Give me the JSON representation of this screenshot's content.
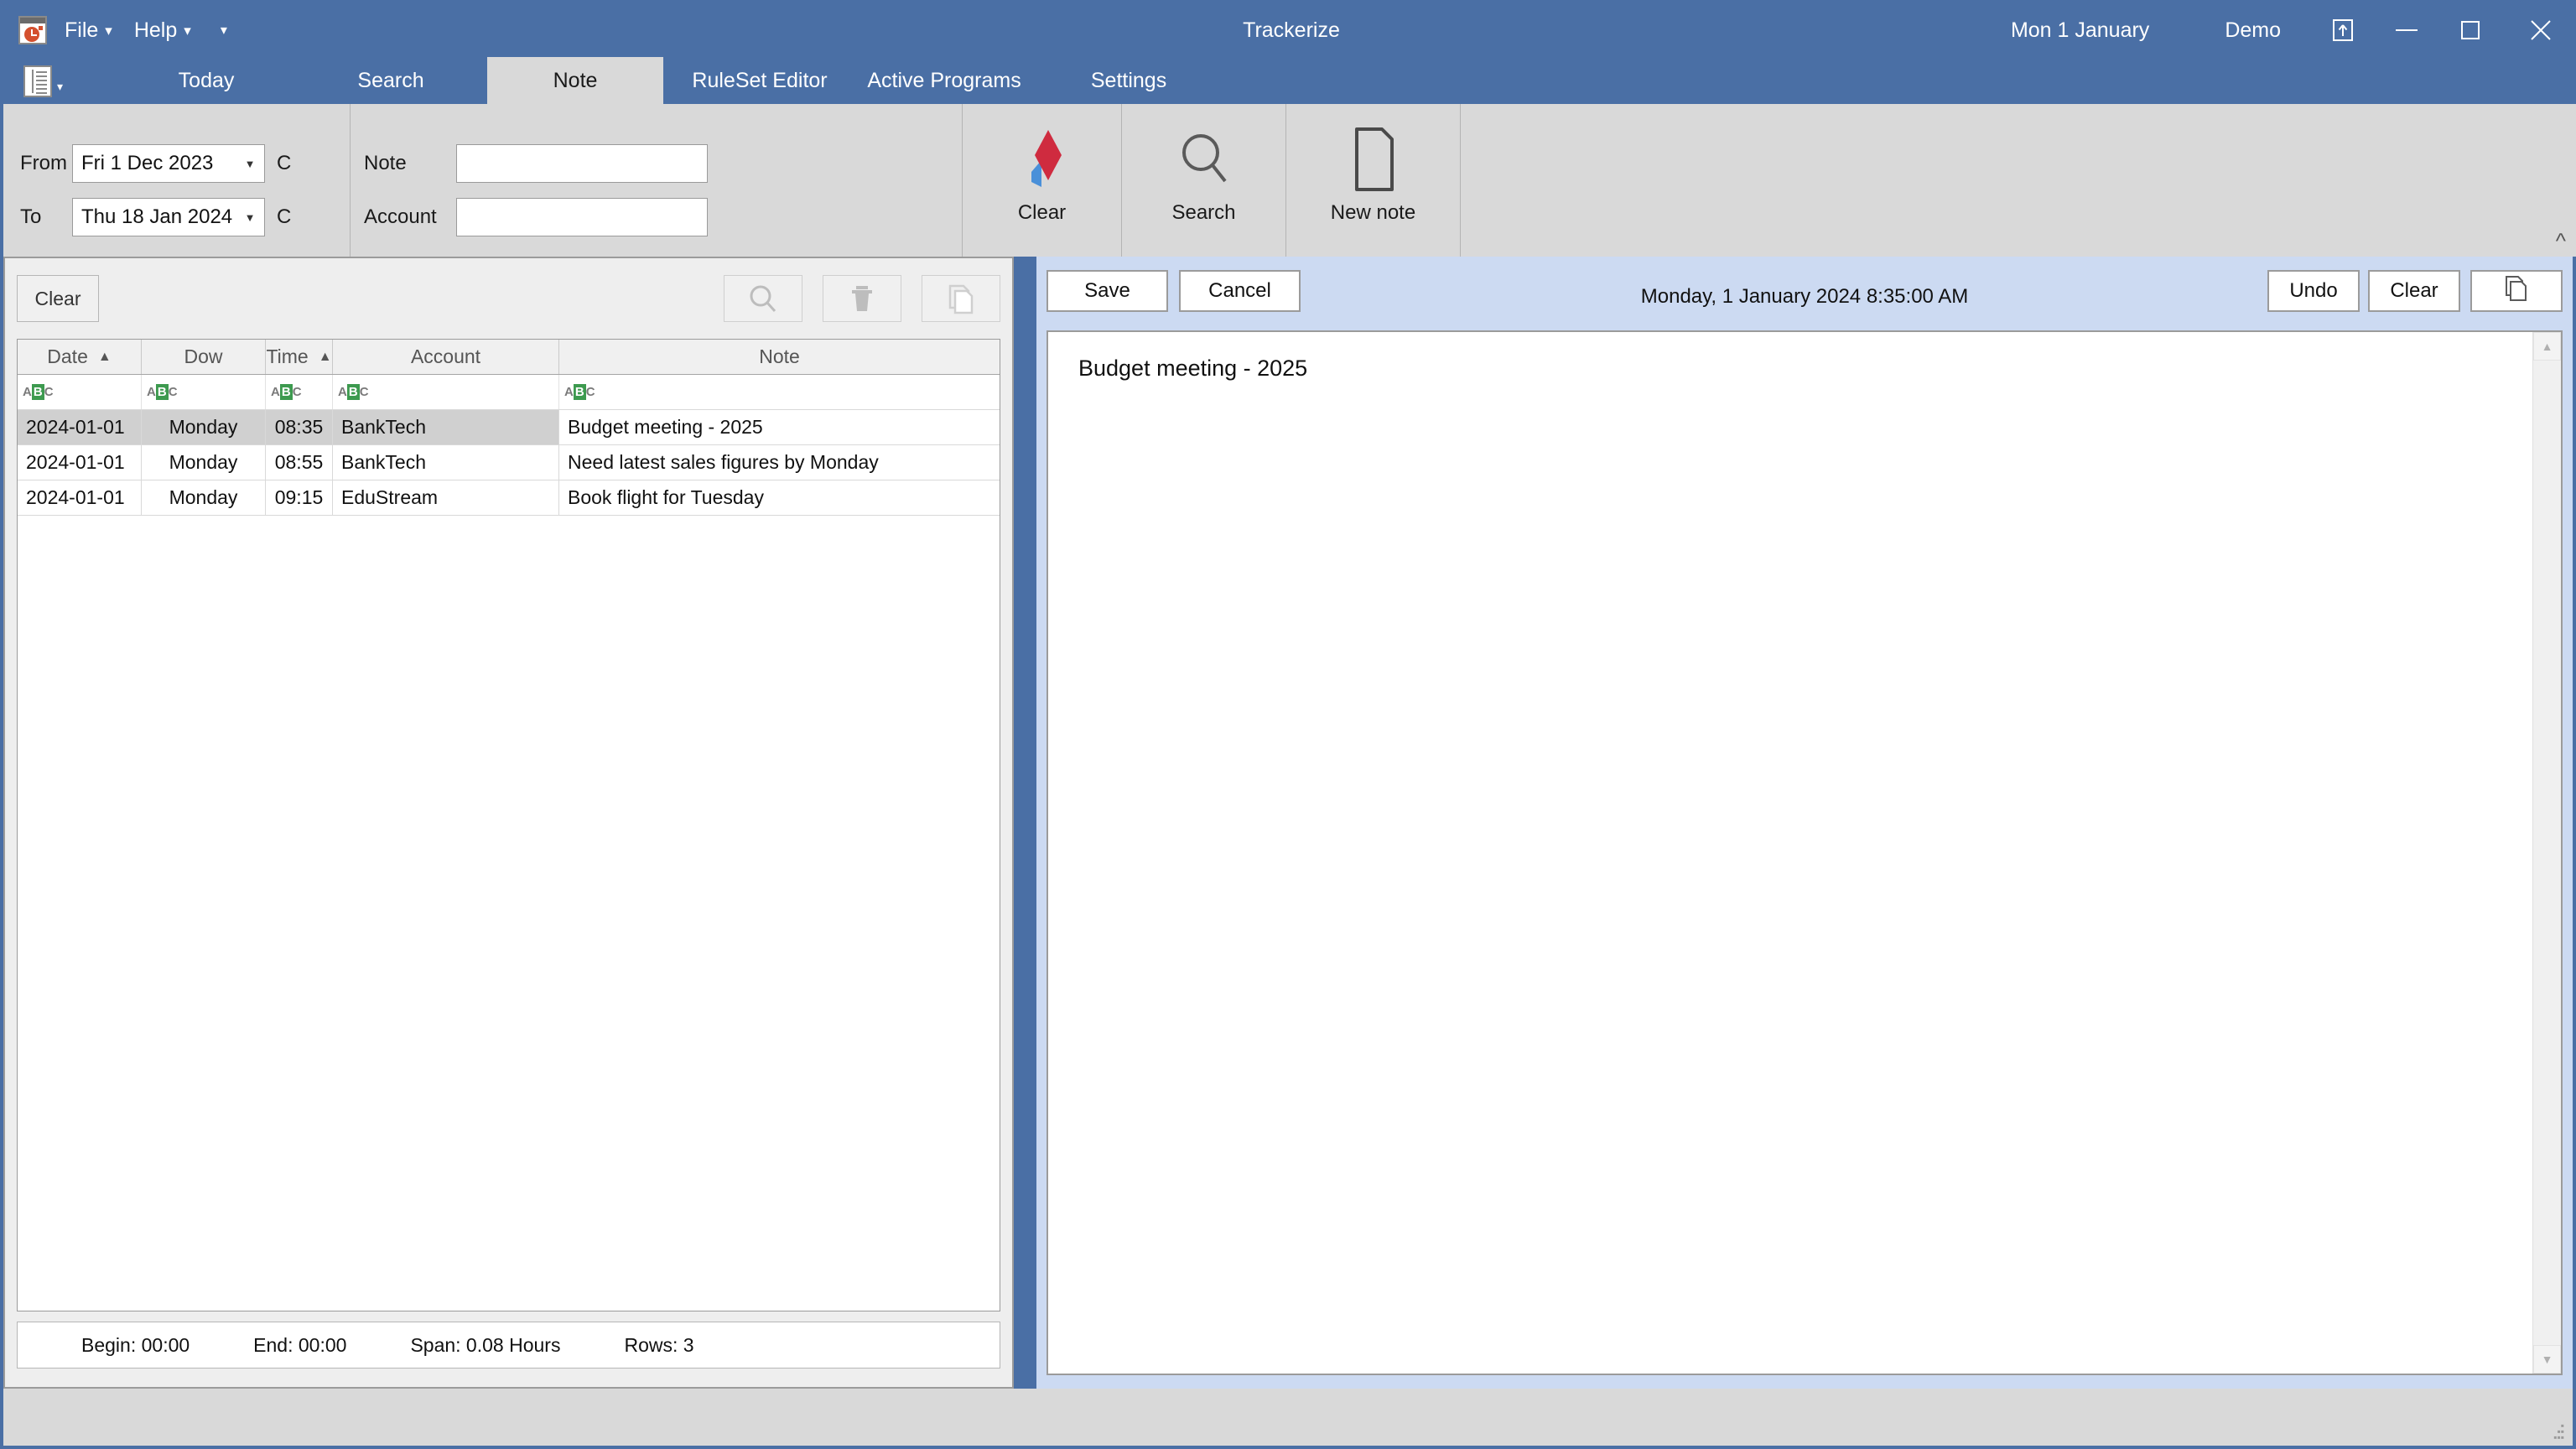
{
  "window": {
    "title": "Trackerize",
    "date_label": "Mon 1 January",
    "mode_label": "Demo",
    "app_icon": "clock-app-icon",
    "pin_icon": "pin-window-icon",
    "minimize_icon": "minimize-icon",
    "maximize_icon": "maximize-icon",
    "close_icon": "close-icon"
  },
  "menu": {
    "file": "File",
    "help": "Help",
    "more_icon": "chevron-down-icon"
  },
  "tabs": {
    "list_icon": "document-list-icon",
    "items": [
      {
        "label": "Today",
        "active": false
      },
      {
        "label": "Search",
        "active": false
      },
      {
        "label": "Note",
        "active": true
      },
      {
        "label": "RuleSet Editor",
        "active": false
      },
      {
        "label": "Active Programs",
        "active": false
      },
      {
        "label": "Settings",
        "active": false
      }
    ]
  },
  "ribbon": {
    "from_label": "From",
    "from_value": "Fri 1 Dec 2023",
    "from_c": "C",
    "to_label": "To",
    "to_value": "Thu 18 Jan 2024",
    "to_c": "C",
    "note_label": "Note",
    "note_value": "",
    "note_placeholder": "",
    "account_label": "Account",
    "account_value": "",
    "account_placeholder": "",
    "buttons": [
      {
        "label": "Clear",
        "icon": "diamond-clear-icon"
      },
      {
        "label": "Search",
        "icon": "magnifier-icon"
      },
      {
        "label": "New note",
        "icon": "new-document-icon"
      }
    ],
    "collapse_icon": "chevron-up-icon"
  },
  "left_panel": {
    "clear_button": "Clear",
    "icon_buttons": [
      {
        "name": "search-icon",
        "enabled": false
      },
      {
        "name": "delete-icon",
        "enabled": false
      },
      {
        "name": "copy-icon",
        "enabled": false
      }
    ],
    "grid": {
      "columns": [
        {
          "label": "Date",
          "sort": "asc"
        },
        {
          "label": "Dow",
          "sort": ""
        },
        {
          "label": "Time",
          "sort": "asc"
        },
        {
          "label": "Account",
          "sort": ""
        },
        {
          "label": "Note",
          "sort": ""
        }
      ],
      "filter_glyph": {
        "a": "A",
        "b": "B",
        "c": "C",
        "highlight_color": "#3d9a4f"
      },
      "rows": [
        {
          "date": "2024-01-01",
          "dow": "Monday",
          "time": "08:35",
          "account": "BankTech",
          "note": "Budget meeting - 2025",
          "selected": true
        },
        {
          "date": "2024-01-01",
          "dow": "Monday",
          "time": "08:55",
          "account": "BankTech",
          "note": "Need latest sales figures by Monday",
          "selected": false
        },
        {
          "date": "2024-01-01",
          "dow": "Monday",
          "time": "09:15",
          "account": "EduStream",
          "note": "Book flight for Tuesday",
          "selected": false
        }
      ]
    },
    "status": {
      "begin": "Begin: 00:00",
      "end": "End: 00:00",
      "span": "Span: 0.08 Hours",
      "rows": "Rows: 3"
    }
  },
  "right_panel": {
    "save_label": "Save",
    "cancel_label": "Cancel",
    "datetime": "Monday, 1 January 2024 8:35:00 AM",
    "undo_label": "Undo",
    "clear_label": "Clear",
    "copy_icon": "copy-icon",
    "editor_text": "Budget meeting - 2025",
    "scroll_up_icon": "scroll-up-arrow",
    "scroll_down_icon": "scroll-down-arrow"
  },
  "colors": {
    "titlebar": "#4a6fa5",
    "ribbon": "#d9d9d9",
    "right_panel": "#ccdaf2",
    "selection": "#d0d0d0",
    "accent_red": "#cf2b3f",
    "accent_blue": "#4a90d9",
    "filter_green": "#3d9a4f"
  }
}
